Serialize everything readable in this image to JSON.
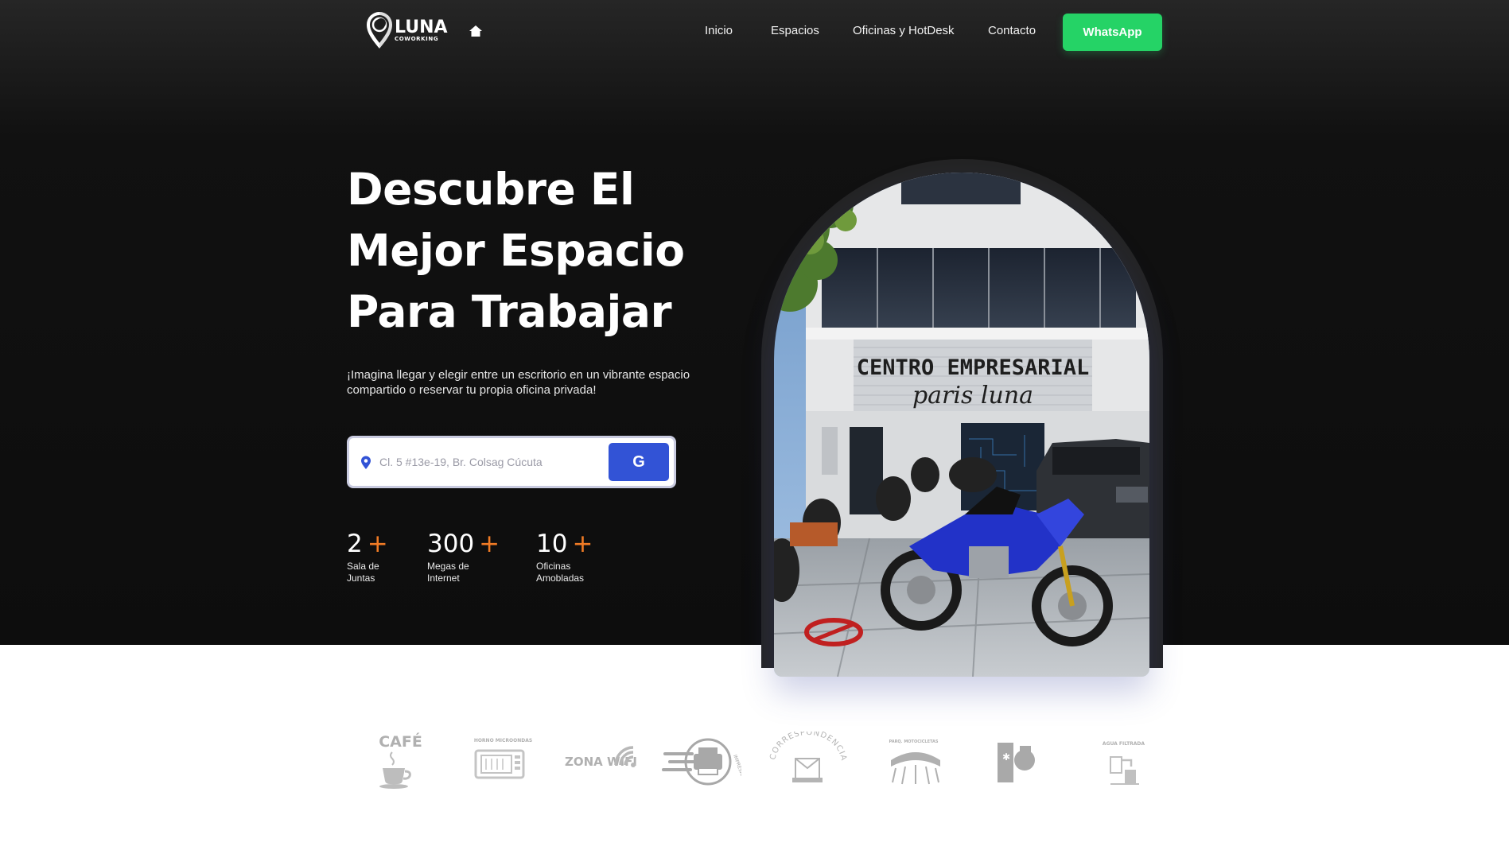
{
  "nav": {
    "logo_word": "LUNA",
    "logo_sub": "COWORKING",
    "links": [
      "Inicio",
      "Espacios",
      "Oficinas y HotDesk",
      "Contacto"
    ],
    "cta_label": "WhatsApp"
  },
  "hero": {
    "headline_lines": [
      "Descubre El",
      "Mejor Espacio",
      "Para Trabajar"
    ],
    "subtitle": "¡Imagina llegar y elegir entre un escritorio en un vibrante espacio compartido o reservar tu propia oficina privada!",
    "search_placeholder": "Cl. 5 #13e-19, Br. Colsag Cúcuta",
    "search_button_label": "G"
  },
  "stats": [
    {
      "number": "2",
      "plus": "+",
      "label": "Sala de Juntas"
    },
    {
      "number": "300",
      "plus": "+",
      "label": "Megas de Internet"
    },
    {
      "number": "10",
      "plus": "+",
      "label": "Oficinas Amobladas"
    }
  ],
  "building": {
    "sign_line1": "CENTRO EMPRESARIAL",
    "sign_line2": "paris luna"
  },
  "amenities": [
    {
      "name": "cafe",
      "label": "CAFÉ"
    },
    {
      "name": "microwave",
      "label": "HORNO MICROONDAS"
    },
    {
      "name": "wifi",
      "label": "ZONA WIFI"
    },
    {
      "name": "printing",
      "label": "IMPRESIONES"
    },
    {
      "name": "mail",
      "label": "CORRESPONDENCIA"
    },
    {
      "name": "parking",
      "label": "PARQ. MOTOCICLETAS"
    },
    {
      "name": "fridge",
      "label": "NEVERA"
    },
    {
      "name": "water",
      "label": "AGUA FILTRADA"
    }
  ],
  "colors": {
    "whatsapp": "#25d366",
    "accent_blue": "#3253d6",
    "accent_orange": "#f07b25"
  }
}
